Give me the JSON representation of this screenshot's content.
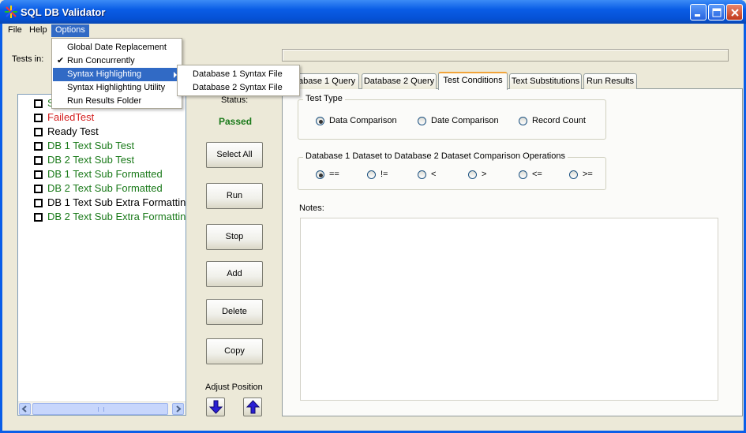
{
  "window": {
    "title": "SQL DB Validator"
  },
  "menubar": {
    "items": [
      "File",
      "Help",
      "Options"
    ]
  },
  "options_menu": {
    "items": [
      {
        "label": "Global Date Replacement",
        "checked": false
      },
      {
        "label": "Run Concurrently",
        "checked": true
      },
      {
        "label": "Syntax Highlighting",
        "checked": false,
        "submenu": true
      },
      {
        "label": "Syntax Highlighting Utility",
        "checked": false
      },
      {
        "label": "Run Results Folder",
        "checked": false
      }
    ],
    "submenu": [
      "Database 1 Syntax File",
      "Database 2 Syntax File"
    ]
  },
  "tests_in_label": "Tests in:",
  "tests": [
    {
      "label": "S",
      "color": "green"
    },
    {
      "label": "FailedTest",
      "color": "red"
    },
    {
      "label": "Ready Test",
      "color": "black"
    },
    {
      "label": "DB 1 Text Sub Test",
      "color": "green"
    },
    {
      "label": "DB 2 Text Sub Test",
      "color": "green"
    },
    {
      "label": "DB 1 Text Sub Formatted",
      "color": "green"
    },
    {
      "label": "DB 2 Text Sub Formatted",
      "color": "green"
    },
    {
      "label": "DB 1 Text Sub Extra Formattin",
      "color": "black"
    },
    {
      "label": "DB 2 Text Sub Extra Formattin",
      "color": "green"
    }
  ],
  "status": {
    "label": "Status:",
    "value": "Passed"
  },
  "buttons": {
    "select_all": "Select All",
    "run": "Run",
    "stop": "Stop",
    "add": "Add",
    "delete": "Delete",
    "copy": "Copy"
  },
  "adjust_position_label": "Adjust Position",
  "tabs": [
    "atabase 1 Query",
    "Database 2 Query",
    "Test Conditions",
    "Text Substitutions",
    "Run Results"
  ],
  "active_tab": "Test Conditions",
  "test_type": {
    "caption": "Test Type",
    "options": [
      "Data Comparison",
      "Date Comparison",
      "Record Count"
    ],
    "selected": "Data Comparison"
  },
  "comparison": {
    "caption": "Database 1 Dataset to Database 2 Dataset Comparison Operations",
    "options": [
      "==",
      "!=",
      "<",
      ">",
      "<=",
      ">="
    ],
    "selected": "=="
  },
  "notes": {
    "label": "Notes:",
    "value": ""
  },
  "colors": {
    "title_bar": "#0a5de6",
    "passed": "#1a7a1a",
    "failed": "#d42020",
    "menu_highlight": "#316ac5"
  }
}
